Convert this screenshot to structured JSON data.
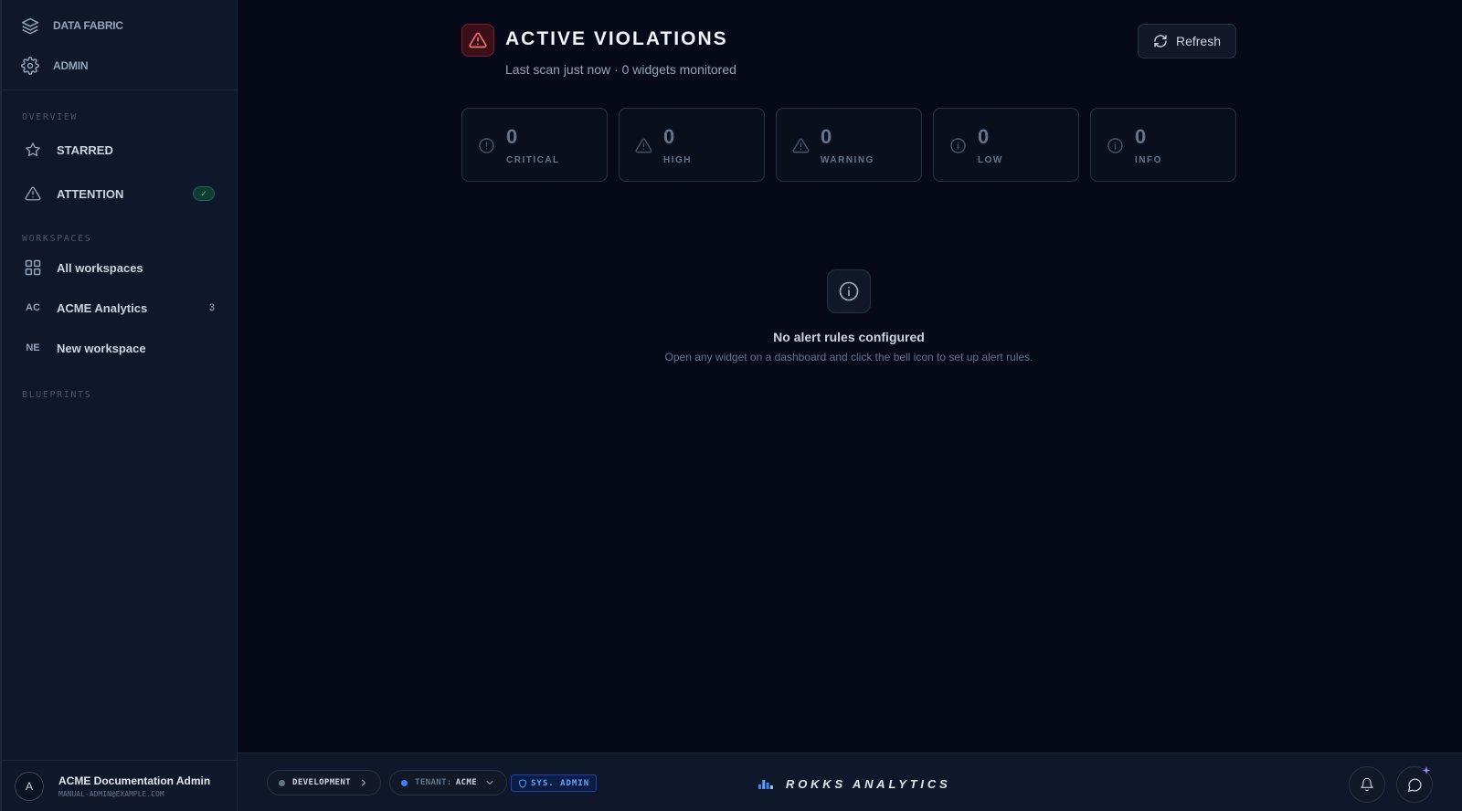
{
  "sidebar": {
    "top_items": [
      {
        "label": "DATA FABRIC",
        "icon": "layers-icon"
      },
      {
        "label": "ADMIN",
        "icon": "gear-icon"
      }
    ],
    "overview_label": "OVERVIEW",
    "overview_items": [
      {
        "label": "STARRED",
        "icon": "star-icon"
      },
      {
        "label": "ATTENTION",
        "icon": "warning-triangle-icon",
        "badge": "✓"
      }
    ],
    "workspaces_label": "WORKSPACES",
    "workspace_items": [
      {
        "label": "All workspaces",
        "icon": "grid-icon"
      },
      {
        "label": "ACME Analytics",
        "abbr": "AC",
        "count": "3"
      },
      {
        "label": "New workspace",
        "abbr": "NE"
      }
    ],
    "blueprints_label": "BLUEPRINTS",
    "user": {
      "initial": "A",
      "name": "ACME Documentation Admin",
      "email": "MANUAL-ADMIN@EXAMPLE.COM"
    }
  },
  "header": {
    "title": "ACTIVE VIOLATIONS",
    "subtitle": "Last scan just now · 0 widgets monitored",
    "refresh_label": "Refresh"
  },
  "severity_cards": [
    {
      "count": "0",
      "label": "CRITICAL",
      "icon": "alert-circle-icon"
    },
    {
      "count": "0",
      "label": "HIGH",
      "icon": "warning-triangle-icon"
    },
    {
      "count": "0",
      "label": "WARNING",
      "icon": "warning-triangle-icon"
    },
    {
      "count": "0",
      "label": "LOW",
      "icon": "info-circle-icon"
    },
    {
      "count": "0",
      "label": "INFO",
      "icon": "info-circle-icon"
    }
  ],
  "empty_state": {
    "icon": "info-circle-icon",
    "title": "No alert rules configured",
    "description": "Open any widget on a dashboard and click the bell icon to set up alert rules."
  },
  "footer": {
    "environment": "DEVELOPMENT",
    "tenant_prefix": "TENANT:",
    "tenant": "ACME",
    "role_badge": "SYS. ADMIN",
    "brand": "ROKKS ANALYTICS"
  },
  "colors": {
    "background": "#060a18",
    "sidebar": "#0f172a",
    "danger": "#f87171",
    "accent_blue": "#60a5fa",
    "success": "#34d399"
  }
}
